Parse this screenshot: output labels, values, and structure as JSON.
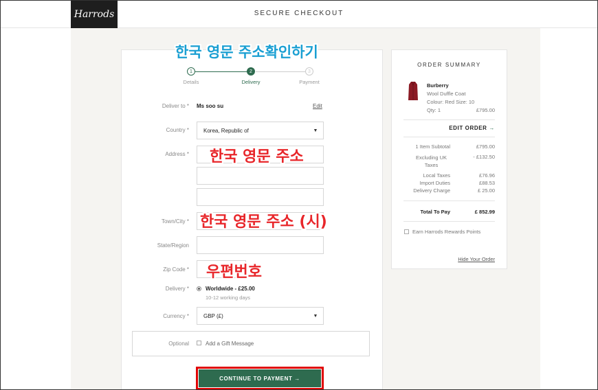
{
  "header": {
    "logo": "Harrods",
    "title": "SECURE CHECKOUT"
  },
  "annotations": {
    "top": "한국 영문 주소확인하기",
    "address": "한국 영문 주소",
    "town": "한국 영문 주소 (시)",
    "zip": "우편번호"
  },
  "steps": [
    {
      "num": "1",
      "label": "Details",
      "state": "done"
    },
    {
      "num": "2",
      "label": "Delivery",
      "state": "active"
    },
    {
      "num": "3",
      "label": "Payment",
      "state": "todo"
    }
  ],
  "form": {
    "deliver_to_label": "Deliver to *",
    "deliver_to_value": "Ms soo su",
    "edit_link": "Edit",
    "country_label": "Country *",
    "country_value": "Korea, Republic of",
    "address_label": "Address *",
    "address_line1": "",
    "address_line2": "",
    "address_line3": "",
    "town_label": "Town/City *",
    "town_value": "",
    "state_label": "State/Region",
    "state_value": "",
    "zip_label": "Zip Code *",
    "zip_value": "",
    "delivery_label": "Delivery *",
    "delivery_option": "Worldwide - £25.00",
    "delivery_time": "10-12 working days",
    "currency_label": "Currency *",
    "currency_value": "GBP (£)",
    "optional_label": "Optional",
    "gift_message_label": "Add a Gift Message",
    "cta_label": "CONTINUE TO PAYMENT →"
  },
  "summary": {
    "title": "ORDER SUMMARY",
    "product": {
      "brand": "Burberry",
      "name": "Wool Duffle Coat",
      "colour_size": "Colour: Red Size: 10",
      "qty": "Qty: 1",
      "price": "£795.00"
    },
    "edit_order": "EDIT ORDER",
    "lines": [
      {
        "label": "1 Item Subtotal",
        "value": "£795.00"
      },
      {
        "label": "Excluding UK Taxes",
        "value": "- £132.50"
      },
      {
        "label": "Local Taxes",
        "value": "£76.96"
      },
      {
        "label": "Import Duties",
        "value": "£88.53"
      },
      {
        "label": "Delivery Charge",
        "value": "£ 25.00"
      }
    ],
    "total_label": "Total To Pay",
    "total_value": "£ 852.99",
    "rewards_label": "Earn Harrods Rewards Points",
    "hide_order": "Hide Your Order"
  },
  "colors": {
    "brand_green": "#2e6b4f",
    "annotation_blue": "#1a9fd2",
    "annotation_red": "#e8262a",
    "highlight_red": "#e00000",
    "product_red": "#8b1a24"
  },
  "icons": [
    "select-arrow-icon",
    "arrow-right-icon",
    "radio-icon",
    "checkbox-icon",
    "product-thumbnail"
  ]
}
